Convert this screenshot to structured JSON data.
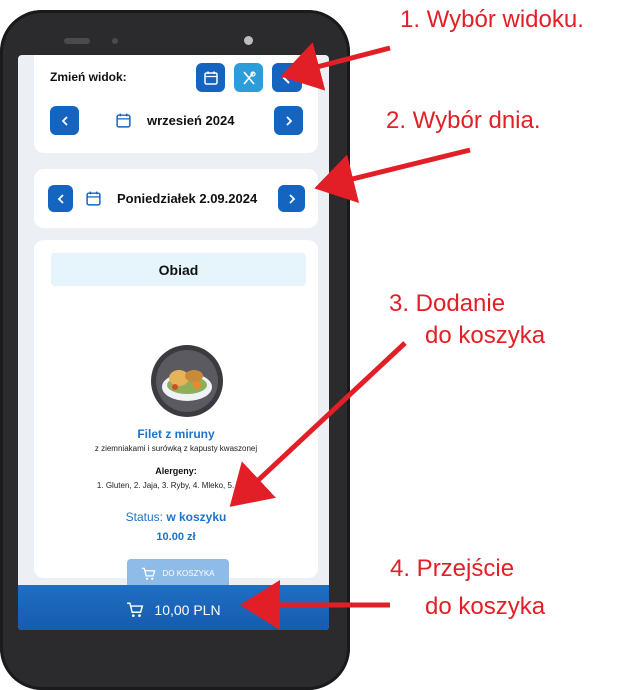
{
  "annotations": {
    "step1": "1. Wybór widoku.",
    "step2": "2. Wybór dnia.",
    "step3_line1": "3. Dodanie",
    "step3_line2": "do koszyka",
    "step4_line1": "4. Przejście",
    "step4_line2": "do koszyka"
  },
  "view_switch": {
    "label": "Zmień widok:",
    "icons": [
      "calendar-icon",
      "cutlery-icon",
      "back-icon"
    ]
  },
  "month_nav": {
    "label": "wrzesień 2024"
  },
  "day_nav": {
    "label": "Poniedziałek 2.09.2024"
  },
  "meal": {
    "category": "Obiad",
    "name": "Filet z miruny",
    "description": "z ziemniakami i surówką z kapusty kwaszonej",
    "allergens_title": "Alergeny:",
    "allergens": "1. Gluten, 2. Jaja, 3. Ryby, 4. Mleko, 5. Seler",
    "status_label": "Status:",
    "status_value": "w koszyku",
    "price": "10.00 zł",
    "add_button": "DO KOSZYKA"
  },
  "cart": {
    "total": "10,00 PLN"
  },
  "colors": {
    "primary": "#1565c0",
    "accent": "#2d9cdb",
    "arrow": "#e21f26"
  }
}
